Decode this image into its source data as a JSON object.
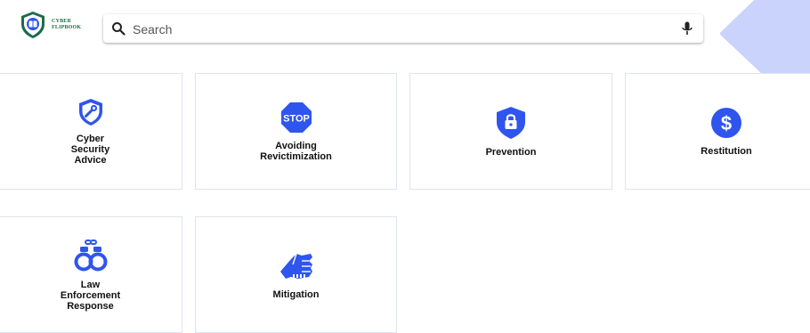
{
  "brand": {
    "line1": "CYBER",
    "line2": "FLIPBOOK"
  },
  "search": {
    "placeholder": "Search",
    "value": ""
  },
  "categories": [
    {
      "label": "Cyber\nSecurity\nAdvice",
      "icon": "shield-tools-icon"
    },
    {
      "label": "Avoiding\nRevictimization",
      "icon": "stop-sign-icon",
      "badge": "STOP"
    },
    {
      "label": "Prevention",
      "icon": "shield-lock-icon"
    },
    {
      "label": "Restitution",
      "icon": "dollar-circle-icon",
      "badge": "$"
    },
    {
      "label": "Law\nEnforcement\nResponse",
      "icon": "handcuffs-icon"
    },
    {
      "label": "Mitigation",
      "icon": "fist-bump-icon"
    }
  ],
  "colors": {
    "accent": "#2f55ee",
    "blob": "#c9d3fb",
    "brand_green": "#1e6b4a"
  }
}
